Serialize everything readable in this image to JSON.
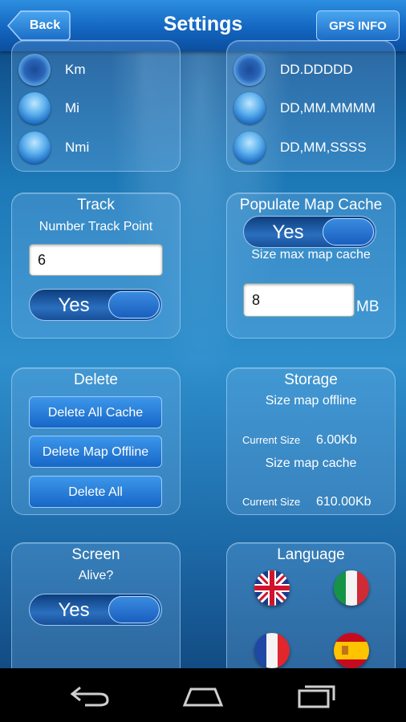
{
  "header": {
    "back_label": "Back",
    "title": "Settings",
    "gps_label": "GPS INFO"
  },
  "units": {
    "options": [
      "Km",
      "Mi",
      "Nmi"
    ],
    "selected": "Km"
  },
  "coord_format": {
    "options": [
      "DD.DDDDD",
      "DD,MM.MMMM",
      "DD,MM,SSSS"
    ],
    "selected": "DD.DDDDD"
  },
  "track": {
    "title": "Track",
    "subtitle": "Number Track Point",
    "value": "6",
    "toggle_label": "Yes"
  },
  "map_cache": {
    "title": "Populate Map Cache",
    "toggle_label": "Yes",
    "size_label": "Size max map cache",
    "value": "8",
    "unit": "MB"
  },
  "delete": {
    "title": "Delete",
    "buttons": [
      "Delete All Cache",
      "Delete Map Offline",
      "Delete All"
    ]
  },
  "storage": {
    "title": "Storage",
    "offline_label": "Size map offline",
    "offline_current_label": "Current Size",
    "offline_value": "6.00Kb",
    "cache_label": "Size map cache",
    "cache_current_label": "Current Size",
    "cache_value": "610.00Kb"
  },
  "screen": {
    "title": "Screen",
    "subtitle": "Alive?",
    "toggle_label": "Yes"
  },
  "language": {
    "title": "Language",
    "flags": [
      "english-flag",
      "italian-flag",
      "french-flag",
      "spanish-flag"
    ]
  },
  "navbar": {
    "icons": [
      "back-nav-icon",
      "home-nav-icon",
      "recent-apps-icon"
    ]
  },
  "colors": {
    "accent": "#1766c7",
    "header": "#1366c0"
  }
}
